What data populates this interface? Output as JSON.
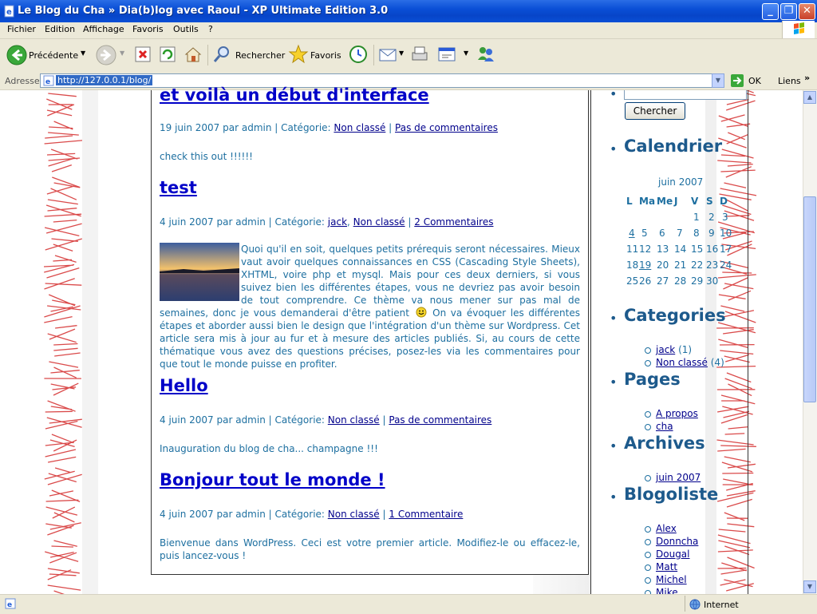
{
  "window": {
    "title": "Le Blog du Cha » Dia(b)log avec Raoul - XP Ultimate Edition 3.0"
  },
  "menu": [
    "Fichier",
    "Edition",
    "Affichage",
    "Favoris",
    "Outils",
    "?"
  ],
  "toolbar": {
    "back_label": "Précédente",
    "search_label": "Rechercher",
    "favorites_label": "Favoris"
  },
  "address": {
    "label": "Adresse",
    "url": "http://127.0.0.1/blog/",
    "go_label": "OK",
    "links_label": "Liens"
  },
  "posts": [
    {
      "title": "et voilà un début d'interface",
      "meta_prefix": "19 juin 2007 par admin | Catégorie: ",
      "categories": [
        "Non classé"
      ],
      "comments": "Pas de commentaires",
      "body": "check this out !!!!!!"
    },
    {
      "title": "test",
      "meta_prefix": "4 juin 2007 par admin | Catégorie: ",
      "categories": [
        "jack",
        "Non classé"
      ],
      "comments": "2 Commentaires",
      "body_part1": "Quoi qu'il en soit, quelques petits prérequis seront nécessaires. Mieux vaut avoir quelques connaissances en CSS (Cascading Style Sheets), XHTML, voire php et mysql. Mais pour ces deux derniers, si vous suivez bien les différentes étapes, vous ne devriez pas avoir besoin de tout comprendre. Ce thème va nous mener sur pas mal de semaines, donc je vous demanderai d'être patient",
      "body_part2": "On va évoquer les différentes étapes et aborder aussi bien le design que l'intégration d'un thème sur Wordpress. Cet article sera mis à jour au fur et à mesure des articles publiés. Si, au cours de cette thématique vous avez des questions précises, posez-les via les commentaires pour que tout le monde puisse en profiter."
    },
    {
      "title": "Hello",
      "meta_prefix": "4 juin 2007 par admin | Catégorie: ",
      "categories": [
        "Non classé"
      ],
      "comments": "Pas de commentaires",
      "body": "Inauguration du blog de cha... champagne !!!"
    },
    {
      "title": "Bonjour tout le monde !",
      "meta_prefix": "4 juin 2007 par admin | Catégorie: ",
      "categories": [
        "Non classé"
      ],
      "comments": "1 Commentaire",
      "body": "Bienvenue dans WordPress. Ceci est votre premier article. Modifiez-le ou effacez-le, puis lancez-vous !"
    }
  ],
  "sidebar": {
    "search_button": "Chercher",
    "calendar": {
      "heading": "Calendrier",
      "caption": "juin 2007",
      "days": [
        "L",
        "Ma",
        "Me",
        "J",
        "V",
        "S",
        "D"
      ],
      "rows": [
        [
          "",
          "",
          "",
          "",
          "1",
          "2",
          "3"
        ],
        [
          "4",
          "5",
          "6",
          "7",
          "8",
          "9",
          "10"
        ],
        [
          "11",
          "12",
          "13",
          "14",
          "15",
          "16",
          "17"
        ],
        [
          "18",
          "19",
          "20",
          "21",
          "22",
          "23",
          "24"
        ],
        [
          "25",
          "26",
          "27",
          "28",
          "29",
          "30",
          ""
        ]
      ],
      "linked_days": [
        "4",
        "19"
      ]
    },
    "categories": {
      "heading": "Categories",
      "items": [
        {
          "label": "jack",
          "count": "(1)"
        },
        {
          "label": "Non classé",
          "count": "(4)"
        }
      ]
    },
    "pages": {
      "heading": "Pages",
      "items": [
        "A propos",
        "cha"
      ]
    },
    "archives": {
      "heading": "Archives",
      "items": [
        "juin 2007"
      ]
    },
    "blogroll": {
      "heading": "Blogoliste",
      "items": [
        "Alex",
        "Donncha",
        "Dougal",
        "Matt",
        "Michel",
        "Mike"
      ]
    }
  },
  "status": {
    "zone": "Internet"
  },
  "colors": {
    "title_bar": "#0a4fd6",
    "post_title": "#0000c8",
    "text": "#1d6fa0",
    "decor_red": "#d42a2a"
  }
}
